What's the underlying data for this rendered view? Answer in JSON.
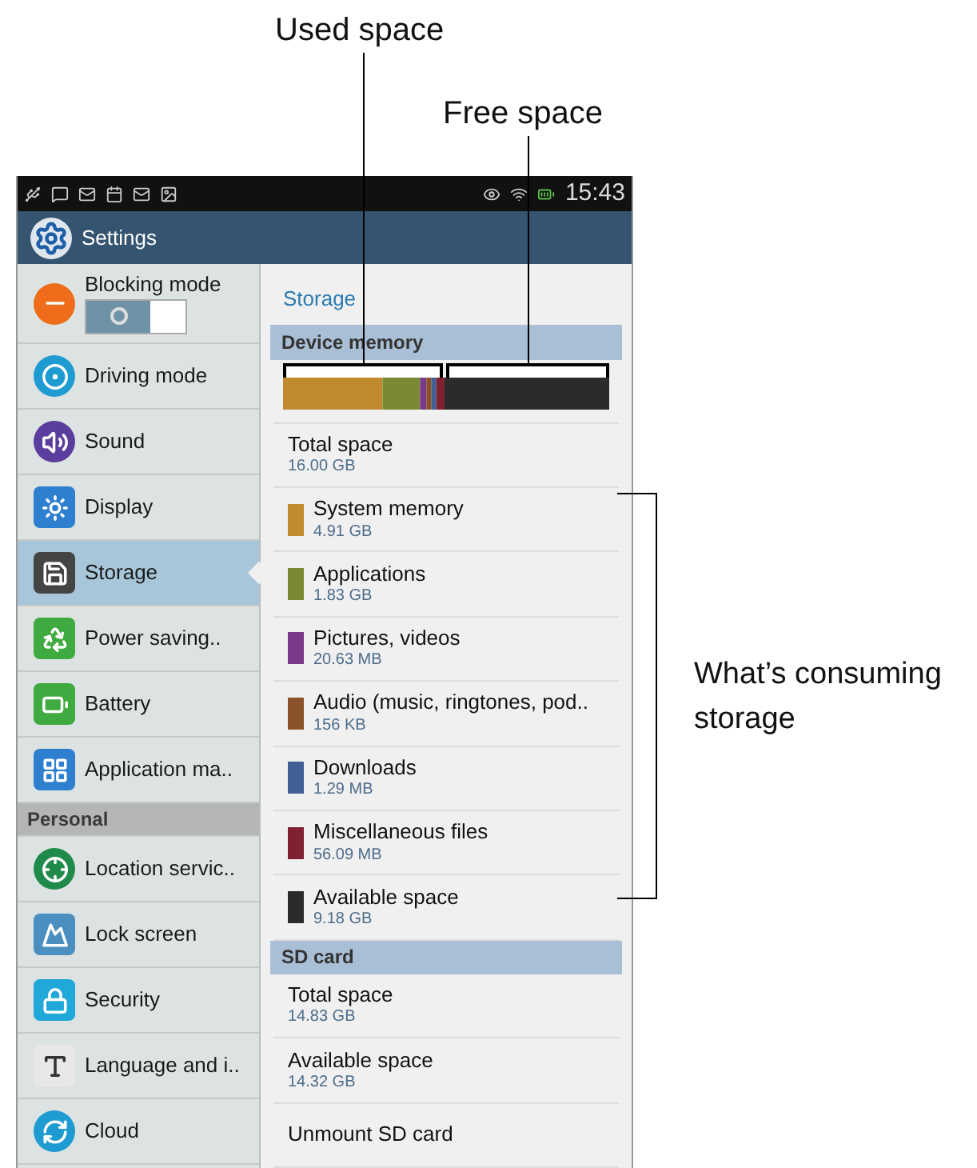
{
  "callouts": {
    "used": "Used space",
    "free": "Free space",
    "consuming": "What’s consuming storage"
  },
  "status_bar": {
    "time": "15:43"
  },
  "app_bar": {
    "title": "Settings"
  },
  "sidebar": {
    "items": [
      {
        "kind": "toggle",
        "label": "Blocking mode",
        "on": false
      },
      {
        "kind": "item",
        "label": "Driving mode",
        "selected": false
      },
      {
        "kind": "item",
        "label": "Sound",
        "selected": false
      },
      {
        "kind": "item",
        "label": "Display",
        "selected": false
      },
      {
        "kind": "item",
        "label": "Storage",
        "selected": true
      },
      {
        "kind": "item",
        "label": "Power saving..",
        "selected": false
      },
      {
        "kind": "item",
        "label": "Battery",
        "selected": false
      },
      {
        "kind": "item",
        "label": "Application ma..",
        "selected": false
      },
      {
        "kind": "header",
        "label": "Personal"
      },
      {
        "kind": "item",
        "label": "Location servic..",
        "selected": false
      },
      {
        "kind": "item",
        "label": "Lock screen",
        "selected": false
      },
      {
        "kind": "item",
        "label": "Security",
        "selected": false
      },
      {
        "kind": "item",
        "label": "Language and i..",
        "selected": false
      },
      {
        "kind": "item",
        "label": "Cloud",
        "selected": false
      }
    ]
  },
  "content": {
    "title": "Storage",
    "device_memory": {
      "header": "Device memory",
      "total": {
        "label": "Total space",
        "value": "16.00 GB"
      },
      "categories": [
        {
          "label": "System memory",
          "value": "4.91 GB",
          "color": "#c18a2e"
        },
        {
          "label": "Applications",
          "value": "1.83 GB",
          "color": "#7a8a34"
        },
        {
          "label": "Pictures, videos",
          "value": "20.63 MB",
          "color": "#7a3a8a"
        },
        {
          "label": "Audio (music, ringtones, pod..",
          "value": "156 KB",
          "color": "#8a5228"
        },
        {
          "label": "Downloads",
          "value": "1.29 MB",
          "color": "#3f5f95"
        },
        {
          "label": "Miscellaneous files",
          "value": "56.09 MB",
          "color": "#7f2130"
        },
        {
          "label": "Available space",
          "value": "9.18 GB",
          "color": "#2b2b2b"
        }
      ]
    },
    "sd_card": {
      "header": "SD card",
      "rows": [
        {
          "label": "Total space",
          "value": "14.83 GB"
        },
        {
          "label": "Available space",
          "value": "14.32 GB"
        },
        {
          "label": "Unmount SD card"
        }
      ]
    }
  }
}
